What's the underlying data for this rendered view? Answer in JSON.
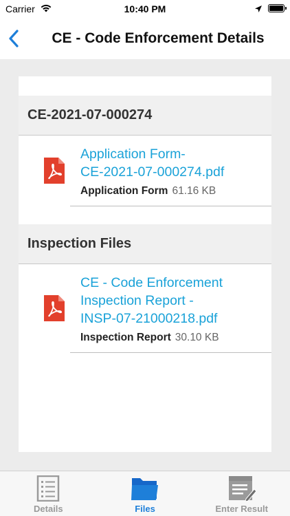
{
  "status_bar": {
    "carrier": "Carrier",
    "time": "10:40 PM"
  },
  "nav": {
    "title": "CE - Code Enforcement Details"
  },
  "sections": [
    {
      "header": "CE-2021-07-000274",
      "files": [
        {
          "name": "Application Form-\nCE-2021-07-000274.pdf",
          "type": "Application Form",
          "size": "61.16 KB",
          "icon": "pdf-icon"
        }
      ]
    },
    {
      "header": "Inspection Files",
      "files": [
        {
          "name": "CE - Code Enforcement\nInspection Report -\nINSP-07-21000218.pdf",
          "type": "Inspection Report",
          "size": "30.10 KB",
          "icon": "pdf-icon"
        }
      ]
    }
  ],
  "tabs": [
    {
      "label": "Details",
      "icon": "details-icon",
      "active": false
    },
    {
      "label": "Files",
      "icon": "folder-icon",
      "active": true
    },
    {
      "label": "Enter Result",
      "icon": "enter-result-icon",
      "active": false
    }
  ],
  "colors": {
    "accent": "#1e7fd9",
    "link": "#1aa2d8",
    "pdf": "#e2402c"
  }
}
